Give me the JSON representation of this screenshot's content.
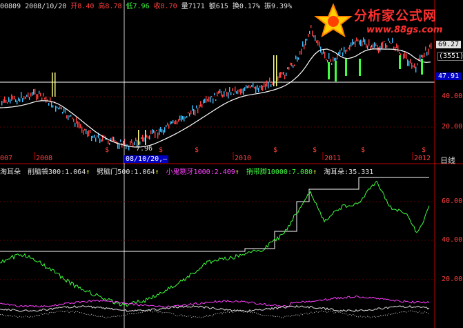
{
  "header": {
    "code": "00809",
    "date": "2008/10/20",
    "open_label": "开",
    "open": "8.40",
    "high_label": "高",
    "high": "8.78",
    "low_label": "低",
    "low": "7.96",
    "close_label": "收",
    "close": "8.70",
    "volume_label": "量",
    "volume": "7171",
    "amount_label": "额",
    "amount": "615",
    "turnover_label": "换",
    "turnover": "0.17%",
    "amplitude_label": "振",
    "amplitude": "9.39%"
  },
  "logo": {
    "name": "分析家公式网",
    "url": "www.88gs.com"
  },
  "price_panel": {
    "axis_labels": [
      "40.00",
      "20.00"
    ],
    "current_price": "69.27",
    "volume_box": "(3551)",
    "level_price": "47.91",
    "low_annotation": "7.96",
    "cursor_date": "08/10/20,—",
    "year_labels": [
      "007",
      "2008",
      "2010",
      "2011",
      "2012"
    ],
    "period": "日线"
  },
  "indicator_panel": {
    "name": "淘耳朵",
    "items": [
      {
        "label": "削脑袋300:",
        "value": "1.064",
        "color": "#e0e0e0"
      },
      {
        "label": "劈脑门500:",
        "value": "1.064",
        "color": "#e0e0e0"
      },
      {
        "label": "小鬼剔牙1000:",
        "value": "2.409",
        "color": "#ff40ff"
      },
      {
        "label": "捎带脚10000:",
        "value": "7.080",
        "color": "#40ff40"
      },
      {
        "label": "淘耳朵:",
        "value": "35.331",
        "color": "#e0e0e0"
      }
    ],
    "axis_labels": [
      "60.00",
      "40.00",
      "20.00"
    ]
  },
  "colors": {
    "up": "#ff4040",
    "down": "#40ff40",
    "axis": "#c00000",
    "ma": "#ffffff",
    "indicator_main": "#40ff40",
    "indicator_pink": "#ff40ff",
    "signal": "#ffff40"
  }
}
